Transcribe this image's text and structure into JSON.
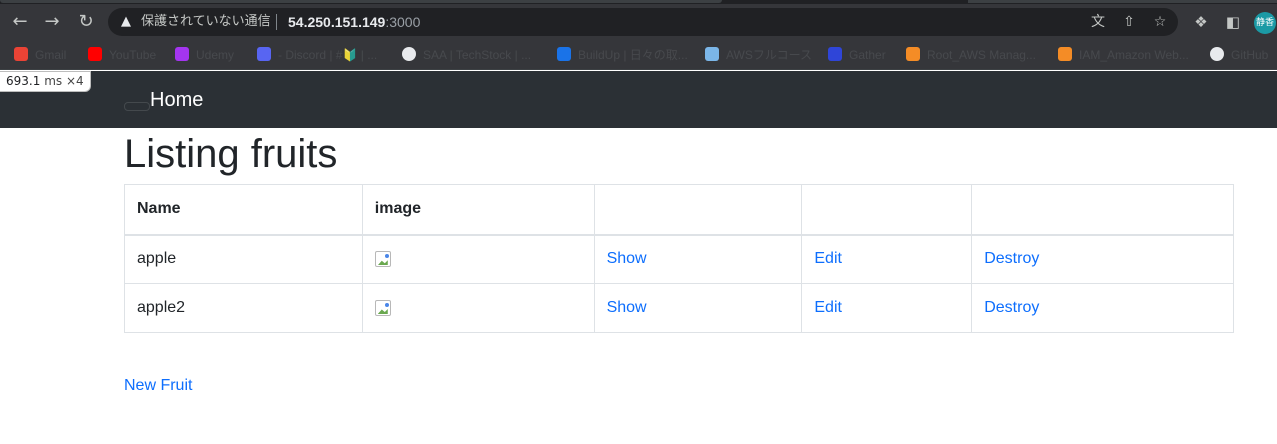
{
  "browser": {
    "security_text": "保護されていない通信",
    "url_host": "54.250.151.149",
    "url_port": ":3000",
    "profile_label": "静香",
    "icons": {
      "back": "back-arrow-icon",
      "forward": "forward-arrow-icon",
      "reload": "reload-icon",
      "warning": "warning-icon",
      "translate": "translate-icon",
      "share": "share-icon",
      "bookmark_star": "star-icon",
      "extensions": "puzzle-icon",
      "side_panel": "side-panel-icon"
    },
    "bookmarks": [
      {
        "label": "Gmail",
        "color": "#ea4335"
      },
      {
        "label": "YouTube",
        "color": "#ff0000"
      },
      {
        "label": "Udemy",
        "color": "#a435f0"
      },
      {
        "label": "- Discord | #🔰 | ...",
        "color": "#5865f2"
      },
      {
        "label": "SAA | TechStock | ...",
        "color": "#e8eaed"
      },
      {
        "label": "BuildUp | 日々の取...",
        "color": "#1a73e8"
      },
      {
        "label": "AWSフルコース",
        "color": "#7bb6e8"
      },
      {
        "label": "Gather",
        "color": "#2f45d8"
      },
      {
        "label": "Root_AWS Manag...",
        "color": "#f48c26"
      },
      {
        "label": "IAM_Amazon Web...",
        "color": "#f48c26"
      },
      {
        "label": "GitHub",
        "color": "#e8eaed"
      }
    ]
  },
  "perf_overlay": {
    "value": "693.1",
    "unit": "ms",
    "mult": "×4"
  },
  "navbar": {
    "brand": "Home"
  },
  "page": {
    "title": "Listing fruits",
    "table": {
      "headers": [
        "Name",
        "image",
        "",
        "",
        ""
      ],
      "rows": [
        {
          "name": "apple",
          "show": "Show",
          "edit": "Edit",
          "destroy": "Destroy"
        },
        {
          "name": "apple2",
          "show": "Show",
          "edit": "Edit",
          "destroy": "Destroy"
        }
      ]
    },
    "new_link": "New Fruit",
    "colors": {
      "link": "#0d6efd",
      "navbar": "#2b3035",
      "text": "#212529"
    }
  }
}
